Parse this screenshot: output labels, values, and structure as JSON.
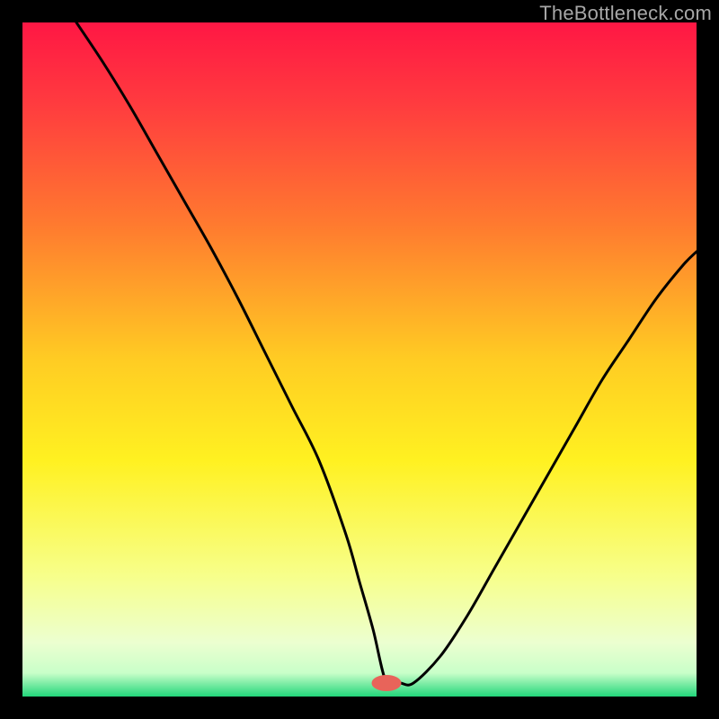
{
  "watermark": "TheBottleneck.com",
  "chart_data": {
    "type": "line",
    "title": "",
    "xlabel": "",
    "ylabel": "",
    "xlim": [
      0,
      100
    ],
    "ylim": [
      0,
      100
    ],
    "grid": false,
    "legend": false,
    "gradient_stops": [
      {
        "offset": 0.0,
        "color": "#ff1744"
      },
      {
        "offset": 0.12,
        "color": "#ff3b3f"
      },
      {
        "offset": 0.3,
        "color": "#ff7a2f"
      },
      {
        "offset": 0.5,
        "color": "#ffcc23"
      },
      {
        "offset": 0.65,
        "color": "#fff121"
      },
      {
        "offset": 0.82,
        "color": "#f7ff8a"
      },
      {
        "offset": 0.92,
        "color": "#ecffd0"
      },
      {
        "offset": 0.965,
        "color": "#c9ffc9"
      },
      {
        "offset": 1.0,
        "color": "#22d67a"
      }
    ],
    "marker": {
      "x": 54,
      "y": 2,
      "color": "#e8645a",
      "rx": 2.2,
      "ry": 1.2
    },
    "series": [
      {
        "name": "bottleneck-curve",
        "x": [
          8,
          12,
          16,
          20,
          24,
          28,
          32,
          36,
          40,
          44,
          48,
          50,
          52,
          54,
          56,
          58,
          62,
          66,
          70,
          74,
          78,
          82,
          86,
          90,
          94,
          98,
          100
        ],
        "values": [
          100,
          94,
          87.5,
          80.5,
          73.5,
          66.5,
          59,
          51,
          43,
          35,
          24,
          17,
          10,
          2,
          2,
          2,
          6,
          12,
          19,
          26,
          33,
          40,
          47,
          53,
          59,
          64,
          66
        ]
      }
    ]
  }
}
